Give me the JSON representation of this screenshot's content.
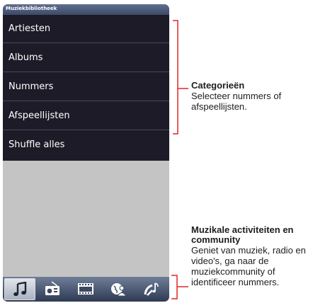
{
  "app": {
    "title": "Muziekbibliotheek"
  },
  "menu": {
    "items": [
      {
        "label": "Artiesten"
      },
      {
        "label": "Albums"
      },
      {
        "label": "Nummers"
      },
      {
        "label": "Afspeellijsten"
      },
      {
        "label": "Shuffle alles"
      }
    ]
  },
  "tabs": [
    {
      "icon": "music-note-icon",
      "active": true
    },
    {
      "icon": "radio-icon",
      "active": false
    },
    {
      "icon": "film-icon",
      "active": false
    },
    {
      "icon": "community-icon",
      "active": false
    },
    {
      "icon": "identify-song-icon",
      "active": false
    }
  ],
  "callouts": {
    "categories": {
      "title": "Categorieën",
      "text": "Selecteer nummers of afspeellijsten."
    },
    "activities": {
      "title": "Muzikale activiteiten en community",
      "text": "Geniet van muziek, radio en video's, ga naar de muziekcommunity of identificeer nummers."
    }
  },
  "colors": {
    "menu_bg": "#1e1b28",
    "title_bar": "#4a5877",
    "empty_area": "#c4c4c4",
    "tab_bar": "#4a5670"
  }
}
